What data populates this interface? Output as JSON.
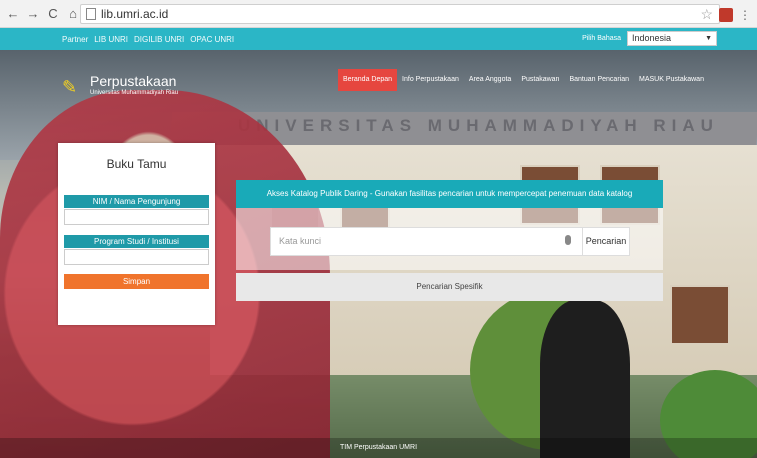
{
  "browser": {
    "url": "lib.umri.ac.id"
  },
  "topbar": {
    "partner_label": "Partner",
    "partners": [
      "LIB UNRI",
      "DIGILIB UNRI",
      "OPAC UNRI"
    ],
    "language_label": "Pilih Bahasa",
    "language_value": "Indonesia"
  },
  "logo": {
    "title": "Perpustakaan",
    "subtitle": "Universitas Muhammadiyah Riau"
  },
  "building_text": "UNIVERSITAS MUHAMMADIYAH RIAU",
  "nav": {
    "items": [
      "Beranda Depan",
      "Info Perpustakaan",
      "Area Anggota",
      "Pustakawan",
      "Bantuan Pencarian",
      "MASUK Pustakawan"
    ]
  },
  "guestbook": {
    "title": "Buku Tamu",
    "field1_label": "NIM / Nama Pengunjung",
    "field2_label": "Program Studi / Institusi",
    "submit": "Simpan"
  },
  "catalog": {
    "banner": "Akses Katalog Publik Daring - Gunakan fasilitas pencarian untuk mempercepat penemuan data katalog",
    "placeholder": "Kata kunci",
    "search_btn": "Pencarian",
    "specific": "Pencarian Spesifik"
  },
  "footer": {
    "text": "TIM Perpustakaan UMRI"
  },
  "colors": {
    "teal": "#2bb6c6",
    "orange": "#f0742c",
    "red": "#e6463f"
  }
}
